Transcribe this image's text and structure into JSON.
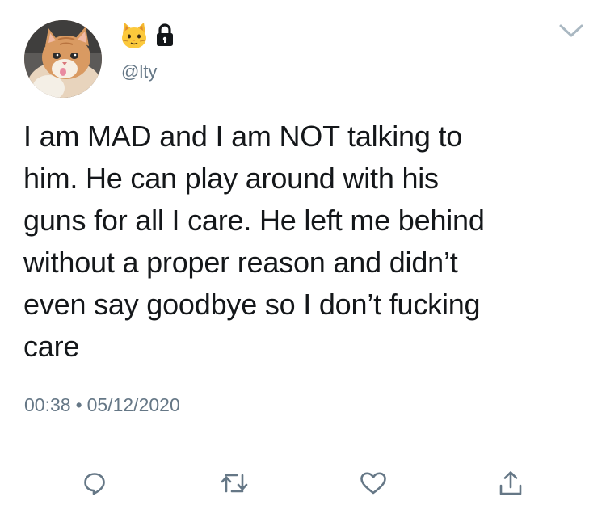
{
  "author": {
    "handle": "@lty",
    "display_name_icon": "cat-face-emoji-icon",
    "protected_icon": "lock-icon",
    "avatar": "cat-avatar"
  },
  "tweet": {
    "text": "I am MAD and I am NOT talking to\nhim. He can play around with his\nguns for all I care. He left me behind\nwithout a proper reason and didn’t\neven say goodbye so I don’t fucking\ncare",
    "time": "00:38",
    "separator": "•",
    "date": "05/12/2020"
  },
  "actions": [
    {
      "icon": "reply-icon"
    },
    {
      "icon": "retweet-icon"
    },
    {
      "icon": "like-heart-icon"
    },
    {
      "icon": "share-icon"
    }
  ],
  "colors": {
    "text": "#14171a",
    "secondary": "#657786",
    "divider": "#d8dee3",
    "action_icon": "#657786",
    "caret": "#aab8c2"
  }
}
